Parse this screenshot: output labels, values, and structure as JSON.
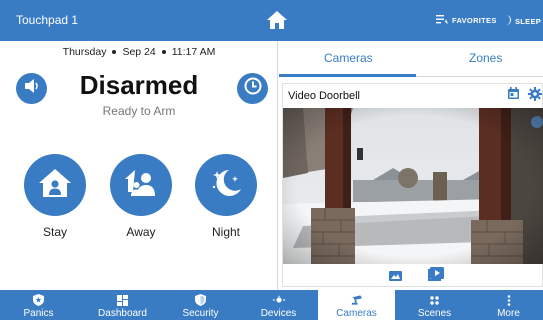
{
  "topbar": {
    "title": "Touchpad 1",
    "home_icon": "home-icon",
    "favorites_label": "FAVORITES",
    "sleep_label": "SLEEP"
  },
  "security": {
    "day": "Thursday",
    "date": "Sep 24",
    "time": "11:17 AM",
    "status": "Disarmed",
    "substatus": "Ready to Arm",
    "modes": [
      {
        "label": "Stay",
        "icon": "house-person-icon"
      },
      {
        "label": "Away",
        "icon": "house-people-away-icon"
      },
      {
        "label": "Night",
        "icon": "moon-stars-icon"
      }
    ]
  },
  "cameras_panel": {
    "tabs": [
      {
        "label": "Cameras",
        "active": true
      },
      {
        "label": "Zones",
        "active": false
      }
    ],
    "camera_name": "Video Doorbell"
  },
  "bottom_nav": [
    {
      "label": "Panics",
      "icon": "shield-star-icon",
      "active": false
    },
    {
      "label": "Dashboard",
      "icon": "grid-icon",
      "active": false
    },
    {
      "label": "Security",
      "icon": "shield-icon",
      "active": false
    },
    {
      "label": "Devices",
      "icon": "bulb-dots-icon",
      "active": false
    },
    {
      "label": "Cameras",
      "icon": "cctv-icon",
      "active": true
    },
    {
      "label": "Scenes",
      "icon": "scenes-icon",
      "active": false
    },
    {
      "label": "More",
      "icon": "more-vertical-icon",
      "active": false
    }
  ],
  "colors": {
    "primary": "#3a7cc4",
    "background": "#ffffff"
  }
}
